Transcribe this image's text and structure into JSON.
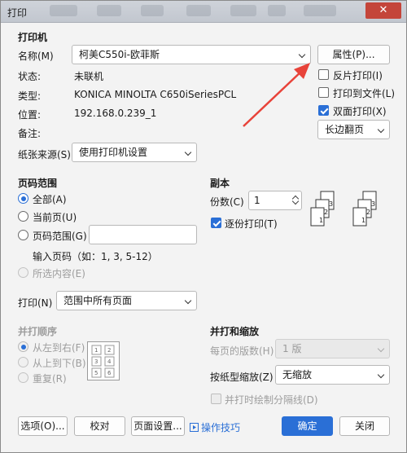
{
  "window": {
    "title": "打印",
    "close": "✕"
  },
  "printer": {
    "section_title": "打印机",
    "name_label": "名称(M)",
    "name_value": "柯美C550i-欧菲斯",
    "properties_button": "属性(P)...",
    "status_label": "状态:",
    "status_value": "未联机",
    "type_label": "类型:",
    "type_value": "KONICA MINOLTA C650iSeriesPCL",
    "location_label": "位置:",
    "location_value": "192.168.0.239_1",
    "comment_label": "备注:",
    "paper_source_label": "纸张来源(S)",
    "paper_source_value": "使用打印机设置",
    "reverse_print": "反片打印(I)",
    "print_to_file": "打印到文件(L)",
    "duplex": "双面打印(X)",
    "duplex_mode": "长边翻页"
  },
  "page_range": {
    "section_title": "页码范围",
    "all": "全部(A)",
    "current": "当前页(U)",
    "pages": "页码范围(G)",
    "pages_value": "",
    "hint": "输入页码（如：1, 3, 5-12）",
    "selection": "所选内容(E)"
  },
  "print_what": {
    "label": "打印(N)",
    "value": "范围中所有页面"
  },
  "copies": {
    "section_title": "副本",
    "count_label": "份数(C)",
    "count_value": "1",
    "collate": "逐份打印(T)",
    "collate_icons": [
      "3",
      "2",
      "1",
      "3",
      "2",
      "1"
    ]
  },
  "order": {
    "section_title": "并打顺序",
    "left_to_right": "从左到右(F)",
    "top_to_bottom": "从上到下(B)",
    "repeat": "重复(R)",
    "preview_cells": [
      "1",
      "2",
      "3",
      "4",
      "5",
      "6"
    ]
  },
  "zoom": {
    "section_title": "并打和缩放",
    "pages_per_sheet_label": "每页的版数(H)",
    "pages_per_sheet_value": "1 版",
    "scale_label": "按纸型缩放(Z)",
    "scale_value": "无缩放",
    "draw_divider": "并打时绘制分隔线(D)"
  },
  "footer": {
    "options": "选项(O)...",
    "proof": "校对",
    "page_setup": "页面设置...",
    "tips": "操作技巧",
    "ok": "确定",
    "close": "关闭"
  },
  "colors": {
    "accent": "#2a6fd6",
    "arrow": "#e8433a"
  }
}
